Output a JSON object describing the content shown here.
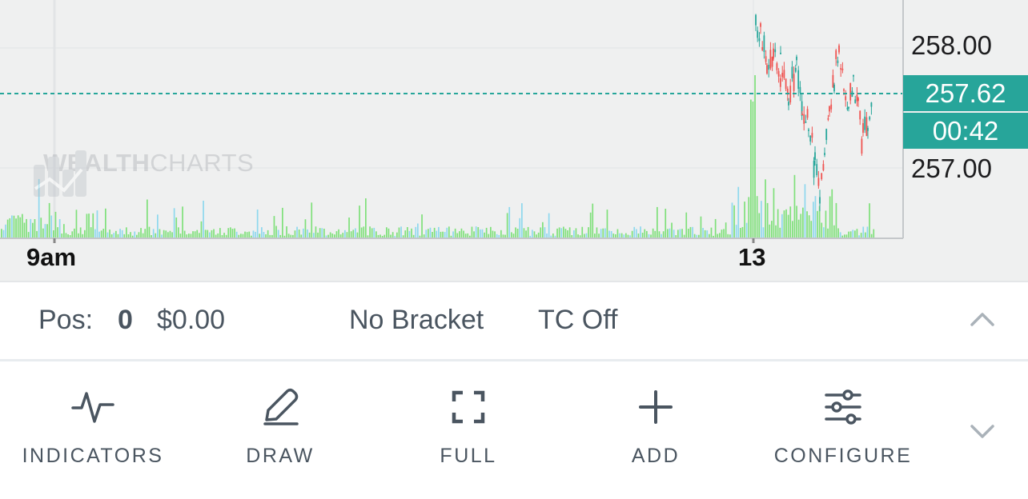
{
  "chart": {
    "watermark": {
      "brand_bold": "WEALTH",
      "brand_light": "CHARTS"
    },
    "price_axis": {
      "upper": "258.00",
      "lower": "257.00"
    },
    "current_price": "257.62",
    "countdown": "00:42",
    "time_axis": {
      "left": "9am",
      "right": "13"
    },
    "colors": {
      "up": "#26a69a",
      "down": "#ef5350",
      "volume": "#7fe07a",
      "volume_alt": "#8ed8ee",
      "price_line": "#26a69a"
    }
  },
  "position_bar": {
    "pos_label": "Pos:",
    "pos_qty": "0",
    "pos_value": "$0.00",
    "bracket": "No Bracket",
    "tc": "TC Off",
    "expand_icon": "chevron-up-icon"
  },
  "toolbar": {
    "indicators": {
      "label": "INDICATORS",
      "icon": "pulse-icon"
    },
    "draw": {
      "label": "DRAW",
      "icon": "pencil-icon"
    },
    "full": {
      "label": "FULL",
      "icon": "fullscreen-icon"
    },
    "add": {
      "label": "ADD",
      "icon": "plus-icon"
    },
    "configure": {
      "label": "CONFIGURE",
      "icon": "sliders-icon"
    },
    "more_icon": "chevron-down-icon"
  }
}
